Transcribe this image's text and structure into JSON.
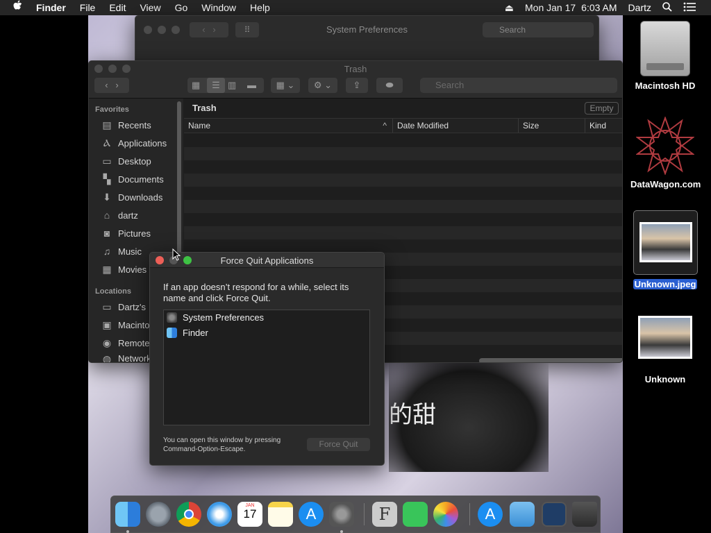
{
  "menubar": {
    "apple": "",
    "app": "Finder",
    "items": [
      "File",
      "Edit",
      "View",
      "Go",
      "Window",
      "Help"
    ],
    "date": "Mon Jan 17",
    "time": "6:03 AM",
    "user": "Dartz",
    "eject_icon": "eject-icon",
    "search_icon": "search-icon",
    "list_icon": "list-icon"
  },
  "sysprefs": {
    "title": "System Preferences",
    "search_placeholder": "Search"
  },
  "finder": {
    "title": "Trash",
    "search_placeholder": "Search",
    "sidebar": {
      "favorites_header": "Favorites",
      "favorites": [
        {
          "label": "Recents",
          "icon": "clock-icon"
        },
        {
          "label": "Applications",
          "icon": "applications-icon"
        },
        {
          "label": "Desktop",
          "icon": "desktop-icon"
        },
        {
          "label": "Documents",
          "icon": "documents-icon"
        },
        {
          "label": "Downloads",
          "icon": "downloads-icon"
        },
        {
          "label": "dartz",
          "icon": "home-icon"
        },
        {
          "label": "Pictures",
          "icon": "camera-icon"
        },
        {
          "label": "Music",
          "icon": "music-icon"
        },
        {
          "label": "Movies",
          "icon": "film-icon"
        }
      ],
      "locations_header": "Locations",
      "locations": [
        {
          "label": "Dartz's",
          "icon": "computer-icon"
        },
        {
          "label": "Macinto",
          "icon": "disk-icon"
        },
        {
          "label": "Remote",
          "icon": "remote-disc-icon"
        },
        {
          "label": "Network",
          "icon": "network-icon"
        }
      ]
    },
    "content": {
      "location": "Trash",
      "empty_button": "Empty",
      "columns": [
        "Name",
        "Date Modified",
        "Size",
        "Kind"
      ]
    }
  },
  "force_quit": {
    "title": "Force Quit Applications",
    "description": "If an app doesn’t respond for a while, select its name and click Force Quit.",
    "apps": [
      {
        "name": "System Preferences",
        "icon": "system-preferences-icon"
      },
      {
        "name": "Finder",
        "icon": "finder-icon"
      }
    ],
    "hint": "You can open this window by pressing Command-Option-Escape.",
    "button": "Force Quit"
  },
  "desktop": {
    "icons": [
      {
        "label": "Macintosh HD",
        "icon": "hard-drive-icon"
      },
      {
        "label": "DataWagon.com",
        "icon": "datawagon-icon"
      },
      {
        "label": "Unknown.jpeg",
        "icon": "image-thumbnail-icon",
        "selected": true
      },
      {
        "label": "Unknown",
        "icon": "image-thumbnail-icon"
      }
    ]
  },
  "dock": {
    "calendar_month": "JAN",
    "calendar_day": "17",
    "apps": [
      "finder-icon",
      "launchpad-icon",
      "chrome-icon",
      "safari-icon",
      "calendar-icon",
      "notes-icon",
      "app-store-icon",
      "system-preferences-icon",
      "fontbook-icon",
      "facetime-icon",
      "photos-icon",
      "app-store-folder-icon",
      "folder-icon",
      "screenshot-icon",
      "trash-icon"
    ]
  },
  "wallpaper_text": "的甜"
}
